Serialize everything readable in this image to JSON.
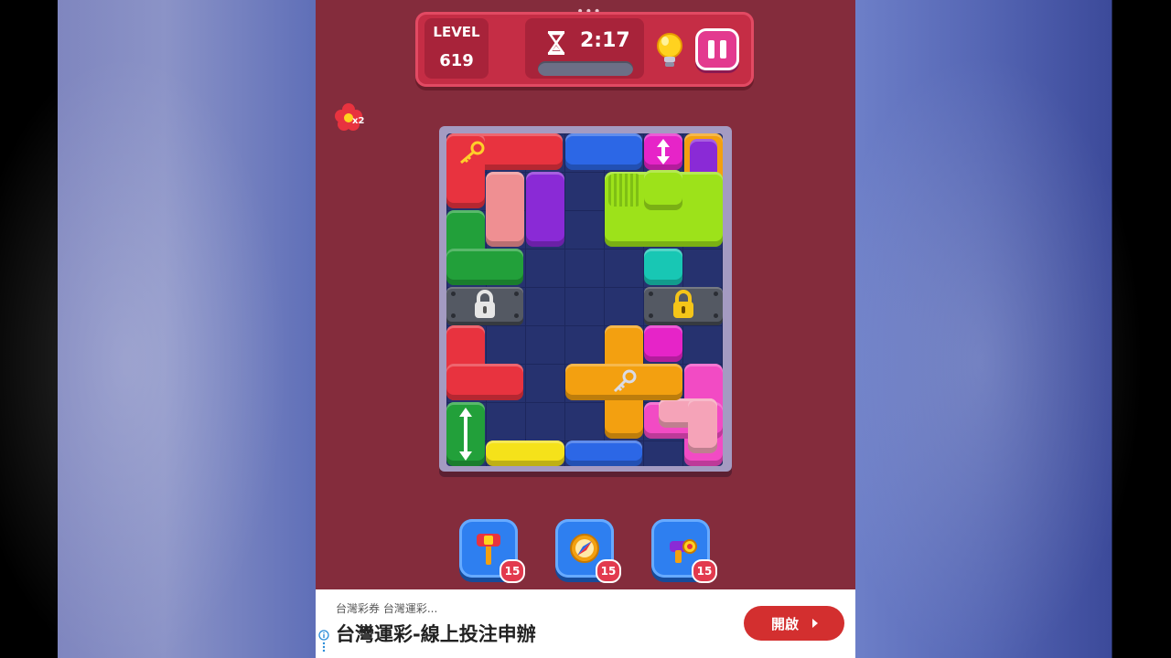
{
  "hud": {
    "level_label": "LEVEL",
    "level_value": "619",
    "timer": "2:17",
    "icons": [
      "hourglass-icon",
      "lightbulb-icon",
      "pause-icon"
    ]
  },
  "flower_badge": {
    "multiplier": "x2",
    "icon": "flower-icon"
  },
  "board": {
    "columns": 7,
    "rows": 9,
    "colors": {
      "red": "#e8333f",
      "blue": "#2c67e6",
      "magenta": "#e624c8",
      "purple": "#8a2ad6",
      "pink": "#ef8f92",
      "green": "#22a03a",
      "lime": "#9de21a",
      "teal": "#18c7b4",
      "orange": "#f3a010",
      "yellow": "#f5e21a",
      "hot-pink": "#f24bc4",
      "light-pink": "#f5a3b8"
    }
  },
  "toolbar": {
    "tools": [
      {
        "name": "hammer",
        "count": "15",
        "icon": "hammer-icon"
      },
      {
        "name": "compass",
        "count": "15",
        "icon": "compass-icon"
      },
      {
        "name": "blaster",
        "count": "15",
        "icon": "blaster-icon"
      }
    ]
  },
  "ad": {
    "source": "台灣彩券 台灣運彩...",
    "headline": "台灣運彩-線上投注申辦",
    "button": "開啟"
  }
}
